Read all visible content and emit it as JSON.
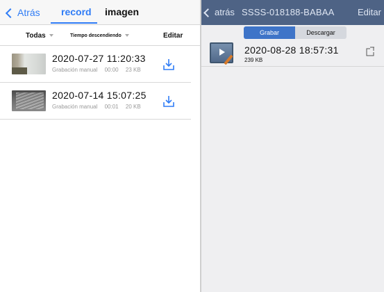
{
  "left": {
    "nav": {
      "back_label": "Atrás",
      "tab_record": "record",
      "tab_image": "imagen"
    },
    "filter": {
      "category": "Todas",
      "sort": "Tiempo descendiendo",
      "edit_label": "Editar"
    },
    "recordings": [
      {
        "title": "2020-07-27  11:20:33",
        "type": "Grabación manual",
        "duration": "00:00",
        "size": "23 KB"
      },
      {
        "title": "2020-07-14  15:07:25",
        "type": "Grabación manual",
        "duration": "00:01",
        "size": "20 KB"
      }
    ]
  },
  "right": {
    "nav": {
      "back_label": "atrás",
      "title": "SSSS-018188-BABAA",
      "edit_label": "Editar"
    },
    "segments": {
      "record": "Grabar",
      "download": "Descargar",
      "selected": "Grabar"
    },
    "videos": [
      {
        "title": "2020-08-28  18:57:31",
        "size": "239 KB"
      }
    ]
  },
  "colors": {
    "accent_blue": "#2f7cf6",
    "right_nav_bg": "#4e6385",
    "segment_on": "#3e74c8"
  }
}
